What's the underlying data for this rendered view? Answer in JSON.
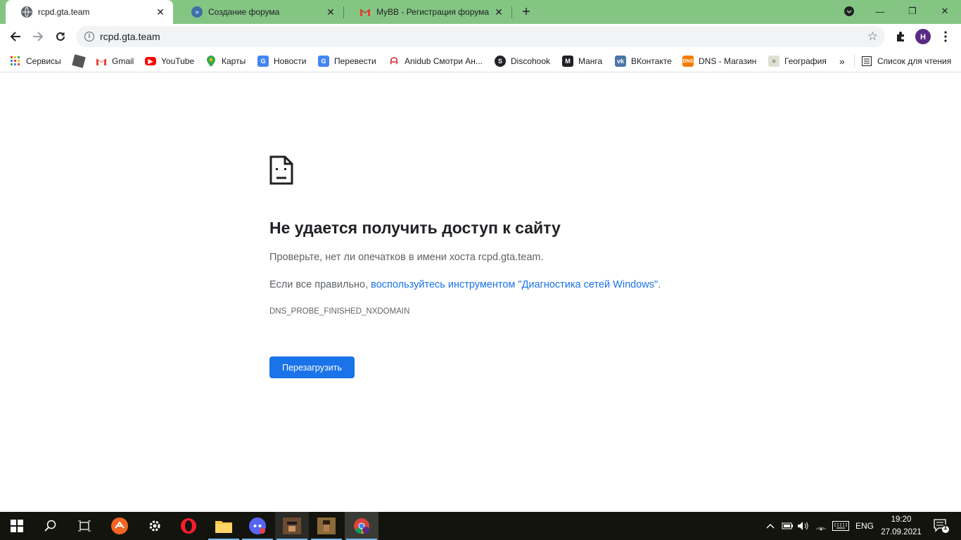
{
  "tabs": [
    {
      "title": "rcpd.gta.team",
      "active": true,
      "favicon": "globe-icon"
    },
    {
      "title": "Создание форума",
      "active": false,
      "favicon": "mybb-icon"
    },
    {
      "title": "MyBB - Регистрация форума - h",
      "active": false,
      "favicon": "gmail-icon"
    }
  ],
  "window_controls": {
    "minimize": "—",
    "restore": "❐",
    "close": "✕"
  },
  "address_bar": {
    "url": "rcpd.gta.team"
  },
  "bookmarks": [
    {
      "label": "Сервисы",
      "icon": "apps-grid-icon"
    },
    {
      "label": "",
      "icon": "roblox-icon"
    },
    {
      "label": "Gmail",
      "icon": "gmail-icon"
    },
    {
      "label": "YouTube",
      "icon": "youtube-icon"
    },
    {
      "label": "Карты",
      "icon": "maps-icon"
    },
    {
      "label": "Новости",
      "icon": "news-icon"
    },
    {
      "label": "Перевести",
      "icon": "translate-icon"
    },
    {
      "label": "Anidub Смотри Ан...",
      "icon": "anidub-icon"
    },
    {
      "label": "Discohook",
      "icon": "discohook-icon"
    },
    {
      "label": "Манга",
      "icon": "manga-icon"
    },
    {
      "label": "ВКонтакте",
      "icon": "vk-icon"
    },
    {
      "label": "DNS - Магазин",
      "icon": "dns-icon"
    },
    {
      "label": "География",
      "icon": "geography-icon"
    }
  ],
  "bookmarks_overflow": "»",
  "reading_list": {
    "label": "Список для чтения",
    "icon": "reading-list-icon"
  },
  "error_page": {
    "title": "Не удается получить доступ к сайту",
    "line1": "Проверьте, нет ли опечатков в имени хоста rcpd.gta.team.",
    "line2_prefix": "Если все правильно, ",
    "line2_link": "воспользуйтесь инструментом \"Диагностика сетей Windows\"",
    "line2_suffix": ".",
    "error_code": "DNS_PROBE_FINISHED_NXDOMAIN",
    "reload_button": "Перезагрузить"
  },
  "taskbar": {
    "language": "ENG",
    "time": "19:20",
    "date": "27.09.2021",
    "notification_count": "1"
  },
  "colors": {
    "frame": "#84c584",
    "link": "#1a73e8",
    "button": "#1a73e8",
    "taskbar": "#14140f"
  }
}
